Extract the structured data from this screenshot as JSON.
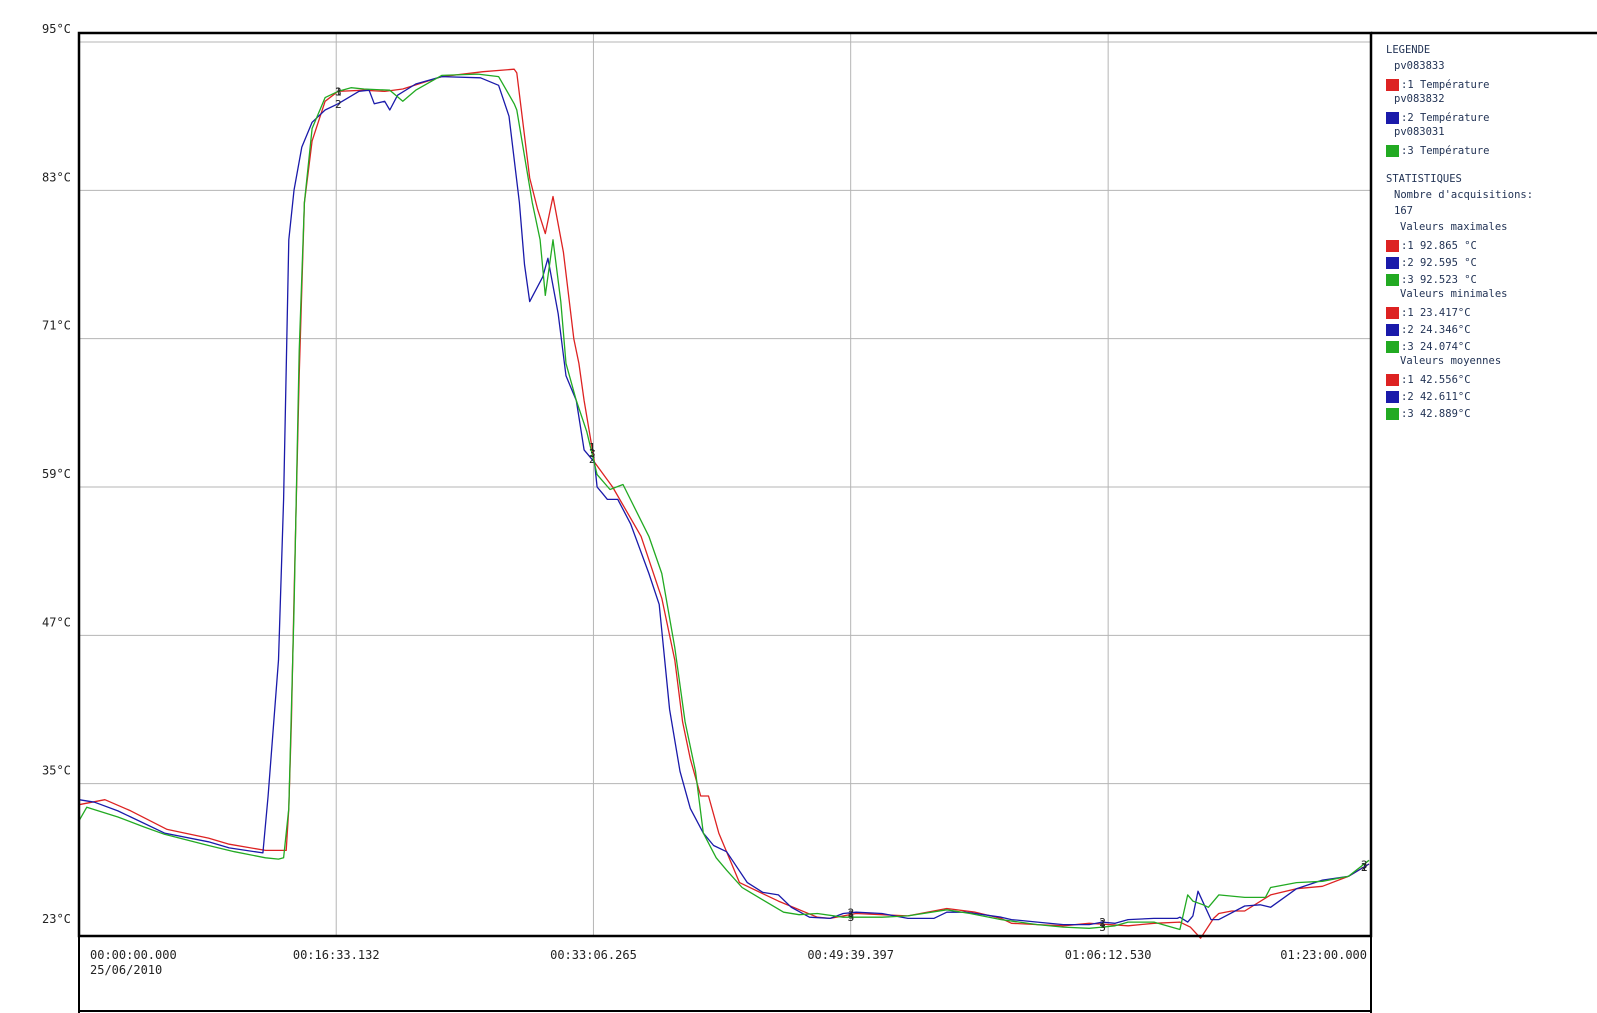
{
  "chart_data": {
    "type": "line",
    "y_ticks": [
      "95°C",
      "83°C",
      "71°C",
      "59°C",
      "47°C",
      "35°C",
      "23°C"
    ],
    "ylim": [
      23,
      95
    ],
    "x_ticks": [
      "00:00:00.000",
      "00:16:33.132",
      "00:33:06.265",
      "00:49:39.397",
      "01:06:12.530",
      "01:23:00.000"
    ],
    "x_tick_seconds": [
      0,
      993,
      1986,
      2979,
      3973,
      4980
    ],
    "x_start_date": "25/06/2010",
    "xlim_seconds": [
      0,
      4980
    ],
    "grid": true,
    "series": [
      {
        "name": "pv083833",
        "marker": "1",
        "color": "#dd2222",
        "t_seconds": [
          0,
          100,
          200,
          340,
          500,
          580,
          720,
          800,
          810,
          820,
          830,
          850,
          870,
          900,
          950,
          1000,
          1100,
          1180,
          1250,
          1400,
          1560,
          1680,
          1690,
          1740,
          1770,
          1800,
          1830,
          1870,
          1910,
          1930,
          1950,
          1990,
          2060,
          2170,
          2250,
          2300,
          2330,
          2360,
          2400,
          2430,
          2470,
          2550,
          2700,
          2850,
          2900,
          3000,
          3100,
          3200,
          3350,
          3460,
          3560,
          3600,
          3700,
          3800,
          3900,
          3980,
          4050,
          4150,
          4250,
          4290,
          4330,
          4380,
          4400,
          4450,
          4500,
          4600,
          4700,
          4800,
          4900,
          4980
        ],
        "values": [
          33.3,
          33.7,
          32.8,
          31.3,
          30.6,
          30.1,
          29.6,
          29.6,
          33.0,
          40.0,
          50.0,
          68.0,
          82.0,
          87.0,
          90.2,
          91.0,
          91.1,
          91.0,
          91.2,
          92.2,
          92.6,
          92.8,
          92.5,
          84.0,
          81.5,
          79.5,
          82.5,
          78.0,
          71.0,
          69.0,
          66.0,
          61.0,
          59.0,
          55.0,
          50.0,
          45.0,
          40.0,
          37.0,
          34.0,
          34.0,
          31.0,
          27.0,
          25.5,
          24.2,
          24.1,
          24.5,
          24.4,
          24.3,
          24.9,
          24.6,
          24.1,
          23.7,
          23.6,
          23.5,
          23.7,
          23.6,
          23.5,
          23.7,
          23.8,
          23.4,
          22.5,
          24.1,
          24.5,
          24.7,
          24.7,
          26.0,
          26.5,
          26.7,
          27.5,
          28.5
        ]
      },
      {
        "name": "pv083832",
        "marker": "2",
        "color": "#1a1aaa",
        "t_seconds": [
          0,
          60,
          150,
          200,
          330,
          500,
          580,
          710,
          730,
          770,
          790,
          810,
          830,
          860,
          900,
          950,
          1000,
          1080,
          1120,
          1140,
          1180,
          1200,
          1230,
          1300,
          1400,
          1550,
          1620,
          1660,
          1700,
          1720,
          1740,
          1790,
          1810,
          1850,
          1880,
          1920,
          1950,
          1990,
          2000,
          2020,
          2040,
          2080,
          2130,
          2200,
          2240,
          2280,
          2320,
          2360,
          2410,
          2450,
          2500,
          2580,
          2640,
          2700,
          2750,
          2820,
          2900,
          2950,
          3000,
          3100,
          3200,
          3300,
          3350,
          3420,
          3460,
          3560,
          3600,
          3700,
          3800,
          3900,
          3950,
          4000,
          4050,
          4150,
          4240,
          4250,
          4280,
          4300,
          4320,
          4370,
          4400,
          4500,
          4560,
          4600,
          4700,
          4800,
          4900,
          4980
        ],
        "values": [
          33.7,
          33.5,
          32.8,
          32.3,
          31.0,
          30.3,
          29.8,
          29.4,
          34.0,
          45.0,
          58.0,
          79.0,
          83.0,
          86.5,
          88.5,
          89.5,
          90.0,
          91.0,
          91.1,
          90.0,
          90.2,
          89.5,
          90.7,
          91.6,
          92.2,
          92.1,
          91.5,
          89.0,
          82.0,
          77.0,
          74.0,
          76.0,
          77.5,
          73.0,
          68.0,
          66.0,
          62.0,
          61.0,
          59.0,
          58.5,
          58.0,
          58.0,
          56.0,
          52.0,
          49.5,
          41.0,
          36.0,
          33.0,
          31.0,
          30.0,
          29.5,
          27.0,
          26.2,
          26.0,
          25.0,
          24.2,
          24.1,
          24.5,
          24.6,
          24.5,
          24.1,
          24.1,
          24.6,
          24.6,
          24.5,
          24.2,
          24.0,
          23.8,
          23.6,
          23.6,
          23.8,
          23.7,
          24.0,
          24.1,
          24.1,
          24.2,
          23.8,
          24.3,
          26.3,
          24.0,
          24.0,
          25.1,
          25.2,
          25.0,
          26.5,
          27.2,
          27.5,
          28.5
        ]
      },
      {
        "name": "pv083031",
        "marker": "3",
        "color": "#22aa22",
        "t_seconds": [
          0,
          30,
          150,
          250,
          330,
          500,
          600,
          720,
          770,
          790,
          810,
          830,
          850,
          870,
          900,
          950,
          1000,
          1050,
          1100,
          1200,
          1250,
          1300,
          1400,
          1540,
          1620,
          1680,
          1690,
          1750,
          1780,
          1800,
          1830,
          1860,
          1880,
          1920,
          1960,
          2000,
          2050,
          2100,
          2200,
          2250,
          2300,
          2340,
          2380,
          2410,
          2460,
          2500,
          2560,
          2640,
          2720,
          2780,
          2850,
          2950,
          3100,
          3200,
          3350,
          3440,
          3560,
          3700,
          3800,
          3900,
          3950,
          4000,
          4050,
          4150,
          4250,
          4280,
          4300,
          4340,
          4360,
          4400,
          4500,
          4580,
          4600,
          4700,
          4800,
          4900,
          4980
        ],
        "values": [
          32.0,
          33.1,
          32.3,
          31.5,
          30.9,
          30.0,
          29.5,
          29.0,
          28.9,
          29.0,
          33.0,
          49.0,
          70.0,
          82.0,
          88.0,
          90.5,
          91.0,
          91.3,
          91.2,
          91.1,
          90.2,
          91.1,
          92.3,
          92.4,
          92.2,
          90.0,
          89.5,
          82.0,
          79.0,
          74.5,
          79.0,
          74.0,
          69.0,
          66.0,
          63.5,
          60.0,
          58.8,
          59.2,
          55.0,
          52.0,
          46.0,
          40.0,
          36.0,
          31.0,
          29.0,
          28.0,
          26.6,
          25.6,
          24.6,
          24.4,
          24.5,
          24.2,
          24.2,
          24.3,
          24.8,
          24.5,
          24.0,
          23.6,
          23.4,
          23.3,
          23.4,
          23.5,
          23.8,
          23.8,
          23.2,
          26.0,
          25.5,
          25.2,
          25.0,
          26.0,
          25.8,
          25.8,
          26.6,
          27.0,
          27.1,
          27.5,
          28.8
        ]
      }
    ]
  },
  "legend": {
    "title": "LEGENDE",
    "entries": [
      {
        "source": "pv083833",
        "label": ":1 Température",
        "color": "#dd2222"
      },
      {
        "source": "pv083832",
        "label": ":2 Température",
        "color": "#1a1aaa"
      },
      {
        "source": "pv083031",
        "label": ":3 Température",
        "color": "#22aa22"
      }
    ]
  },
  "stats": {
    "title": "STATISTIQUES",
    "count_label": "Nombre d'acquisitions:",
    "count_value": "167",
    "max": {
      "label": "Valeurs maximales",
      "rows": [
        ":1 92.865 °C",
        ":2 92.595 °C",
        ":3 92.523 °C"
      ]
    },
    "min": {
      "label": "Valeurs minimales",
      "rows": [
        ":1 23.417°C",
        ":2 24.346°C",
        ":3 24.074°C"
      ]
    },
    "mean": {
      "label": "Valeurs moyennes",
      "rows": [
        ":1 42.556°C",
        ":2 42.611°C",
        ":3 42.889°C"
      ]
    },
    "colors": [
      "#dd2222",
      "#1a1aaa",
      "#22aa22"
    ]
  }
}
